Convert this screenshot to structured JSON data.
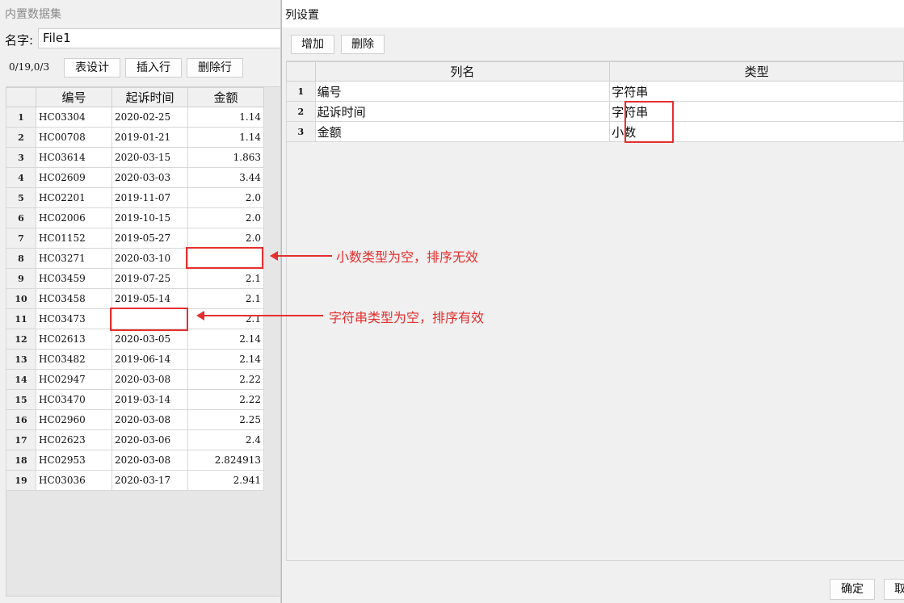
{
  "left_window": {
    "title": "内置数据集",
    "name_label": "名字:",
    "name_value": "File1",
    "row_counter": "0/19,0/3",
    "buttons": {
      "table_design": "表设计",
      "insert_row": "插入行",
      "delete_row": "删除行"
    },
    "table": {
      "headers": [
        "编号",
        "起诉时间",
        "金额"
      ],
      "rows": [
        {
          "n": "1",
          "id": "HC03304",
          "date": "2020-02-25",
          "amount": "1.14"
        },
        {
          "n": "2",
          "id": "HC00708",
          "date": "2019-01-21",
          "amount": "1.14"
        },
        {
          "n": "3",
          "id": "HC03614",
          "date": "2020-03-15",
          "amount": "1.863"
        },
        {
          "n": "4",
          "id": "HC02609",
          "date": "2020-03-03",
          "amount": "3.44"
        },
        {
          "n": "5",
          "id": "HC02201",
          "date": "2019-11-07",
          "amount": "2.0"
        },
        {
          "n": "6",
          "id": "HC02006",
          "date": "2019-10-15",
          "amount": "2.0"
        },
        {
          "n": "7",
          "id": "HC01152",
          "date": "2019-05-27",
          "amount": "2.0"
        },
        {
          "n": "8",
          "id": "HC03271",
          "date": "2020-03-10",
          "amount": ""
        },
        {
          "n": "9",
          "id": "HC03459",
          "date": "2019-07-25",
          "amount": "2.1"
        },
        {
          "n": "10",
          "id": "HC03458",
          "date": "2019-05-14",
          "amount": "2.1"
        },
        {
          "n": "11",
          "id": "HC03473",
          "date": "",
          "amount": "2.1"
        },
        {
          "n": "12",
          "id": "HC02613",
          "date": "2020-03-05",
          "amount": "2.14"
        },
        {
          "n": "13",
          "id": "HC03482",
          "date": "2019-06-14",
          "amount": "2.14"
        },
        {
          "n": "14",
          "id": "HC02947",
          "date": "2020-03-08",
          "amount": "2.22"
        },
        {
          "n": "15",
          "id": "HC03470",
          "date": "2019-03-14",
          "amount": "2.22"
        },
        {
          "n": "16",
          "id": "HC02960",
          "date": "2020-03-08",
          "amount": "2.25"
        },
        {
          "n": "17",
          "id": "HC02623",
          "date": "2020-03-06",
          "amount": "2.4"
        },
        {
          "n": "18",
          "id": "HC02953",
          "date": "2020-03-08",
          "amount": "2.824913"
        },
        {
          "n": "19",
          "id": "HC03036",
          "date": "2020-03-17",
          "amount": "2.941"
        }
      ]
    }
  },
  "dialog": {
    "title": "列设置",
    "buttons": {
      "add": "增加",
      "delete": "删除",
      "ok": "确定",
      "cancel": "取"
    },
    "table": {
      "headers": [
        "列名",
        "类型"
      ],
      "rows": [
        {
          "n": "1",
          "name": "编号",
          "type": "字符串"
        },
        {
          "n": "2",
          "name": "起诉时间",
          "type": "字符串"
        },
        {
          "n": "3",
          "name": "金额",
          "type": "小数"
        }
      ]
    }
  },
  "annotations": {
    "note_decimal_empty": "小数类型为空，排序无效",
    "note_string_empty": "字符串类型为空，排序有效",
    "color": "#e62e2e"
  }
}
